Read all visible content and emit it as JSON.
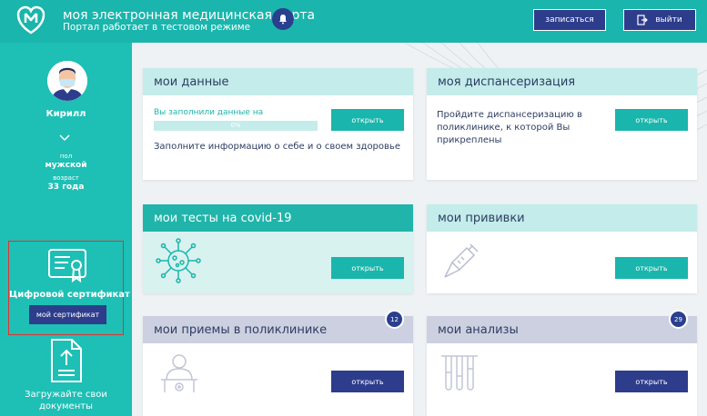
{
  "header": {
    "title": "моя электронная медицинская карта",
    "subtitle": "Портал работает в тестовом режиме",
    "book_label": "записаться",
    "exit_label": "выйти"
  },
  "sidebar": {
    "user_name": "Кирилл",
    "gender_label": "пол",
    "gender_value": "мужской",
    "age_label": "возраст",
    "age_value": "33 года",
    "cert_title": "Цифровой сертификат",
    "cert_button": "мой сертификат",
    "upload_line1": "Загружайте свои",
    "upload_line2": "документы"
  },
  "cards": {
    "my_data": {
      "title": "мои данные",
      "progress_label": "Вы заполнили данные на",
      "progress_value": "0%",
      "progress_fraction": 0,
      "description": "Заполните информацию о себе и о своем здоровье",
      "button": "открыть"
    },
    "dispensary": {
      "title": "моя диспансеризация",
      "line1": "Пройдите диспансеризацию в",
      "line2": "поликлинике, к которой Вы",
      "line3": "прикреплены",
      "button": "открыть"
    },
    "covid": {
      "title": "мои тесты на covid-19",
      "button": "открыть"
    },
    "vaccines": {
      "title": "мои прививки",
      "button": "открыть"
    },
    "appointments": {
      "title": "мои приемы в поликлинике",
      "badge": "12",
      "button": "открыть"
    },
    "analyses": {
      "title": "мои анализы",
      "badge": "29",
      "button": "открыть"
    }
  },
  "colors": {
    "teal": "#1ab5ac",
    "navy": "#2d3d8c",
    "light_teal": "#c4ecea",
    "highlight": "#e0322f"
  }
}
